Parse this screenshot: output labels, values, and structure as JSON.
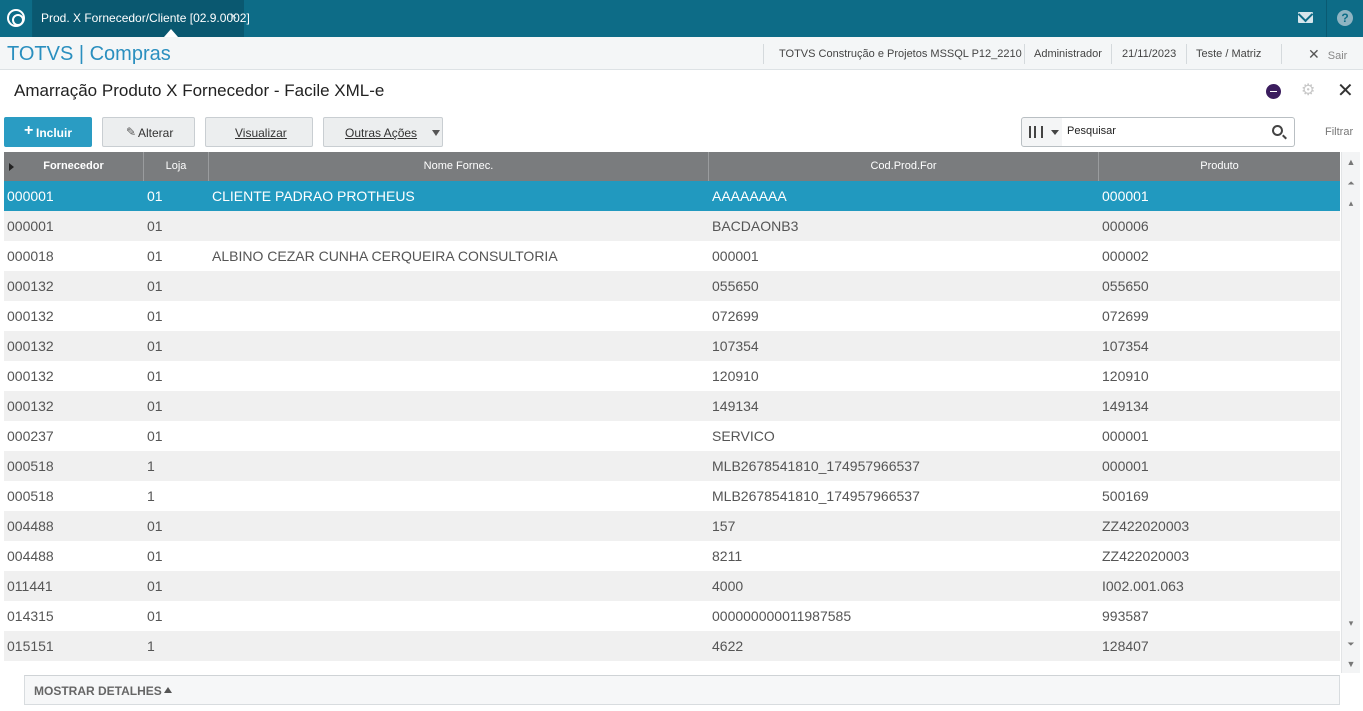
{
  "window": {
    "tab_title": "Prod. X Fornecedor/Cliente [02.9.0002]",
    "tab_close": "×"
  },
  "header": {
    "brand": "TOTVS | Compras",
    "company": "TOTVS Construção e Projetos MSSQL P12_2210",
    "user": "Administrador",
    "date": "21/11/2023",
    "branch": "Teste / Matriz",
    "exit_label": "Sair"
  },
  "page": {
    "title": "Amarração Produto X Fornecedor - Facile XML-e"
  },
  "toolbar": {
    "include": "Incluir",
    "alter": "Alterar",
    "view": "Visualizar",
    "more": "Outras Ações",
    "search_placeholder": "Pesquisar",
    "filter": "Filtrar"
  },
  "grid": {
    "columns": [
      "Fornecedor",
      "Loja",
      "Nome Fornec.",
      "Cod.Prod.For",
      "Produto"
    ],
    "selected_row": 0,
    "rows": [
      [
        "000001",
        "01",
        "CLIENTE PADRAO PROTHEUS",
        "AAAAAAAA",
        "000001"
      ],
      [
        "000001",
        "01",
        "",
        "BACDAONB3",
        "000006"
      ],
      [
        "000018",
        "01",
        "ALBINO CEZAR CUNHA CERQUEIRA CONSULTORIA",
        "000001",
        "000002"
      ],
      [
        "000132",
        "01",
        "",
        "055650",
        "055650"
      ],
      [
        "000132",
        "01",
        "",
        "072699",
        "072699"
      ],
      [
        "000132",
        "01",
        "",
        "107354",
        "107354"
      ],
      [
        "000132",
        "01",
        "",
        "120910",
        "120910"
      ],
      [
        "000132",
        "01",
        "",
        "149134",
        "149134"
      ],
      [
        "000237",
        "01",
        "",
        "SERVICO",
        "000001"
      ],
      [
        "000518",
        "1",
        "",
        "MLB2678541810_174957966537",
        "000001"
      ],
      [
        "000518",
        "1",
        "",
        "MLB2678541810_174957966537",
        "500169"
      ],
      [
        "004488",
        "01",
        "",
        "157",
        "ZZ422020003"
      ],
      [
        "004488",
        "01",
        "",
        "8211",
        "ZZ422020003"
      ],
      [
        "011441",
        "01",
        "",
        "4000",
        "I002.001.063"
      ],
      [
        "014315",
        "01",
        "",
        "000000000011987585",
        "993587"
      ],
      [
        "015151",
        "1",
        "",
        "4622",
        "128407"
      ]
    ]
  },
  "footer": {
    "details": "MOSTRAR DETALHES"
  },
  "colors": {
    "topbar": "#0d6c87",
    "brand": "#2a8fbf",
    "selected_row": "#2199bf",
    "header_bg": "#7a7c7e"
  },
  "icons": [
    "totvs-logo-icon",
    "mail-icon",
    "help-icon",
    "ellipse-e-icon",
    "gear-icon",
    "close-icon",
    "plus-icon",
    "pencil-icon",
    "columns-icon",
    "search-icon"
  ]
}
